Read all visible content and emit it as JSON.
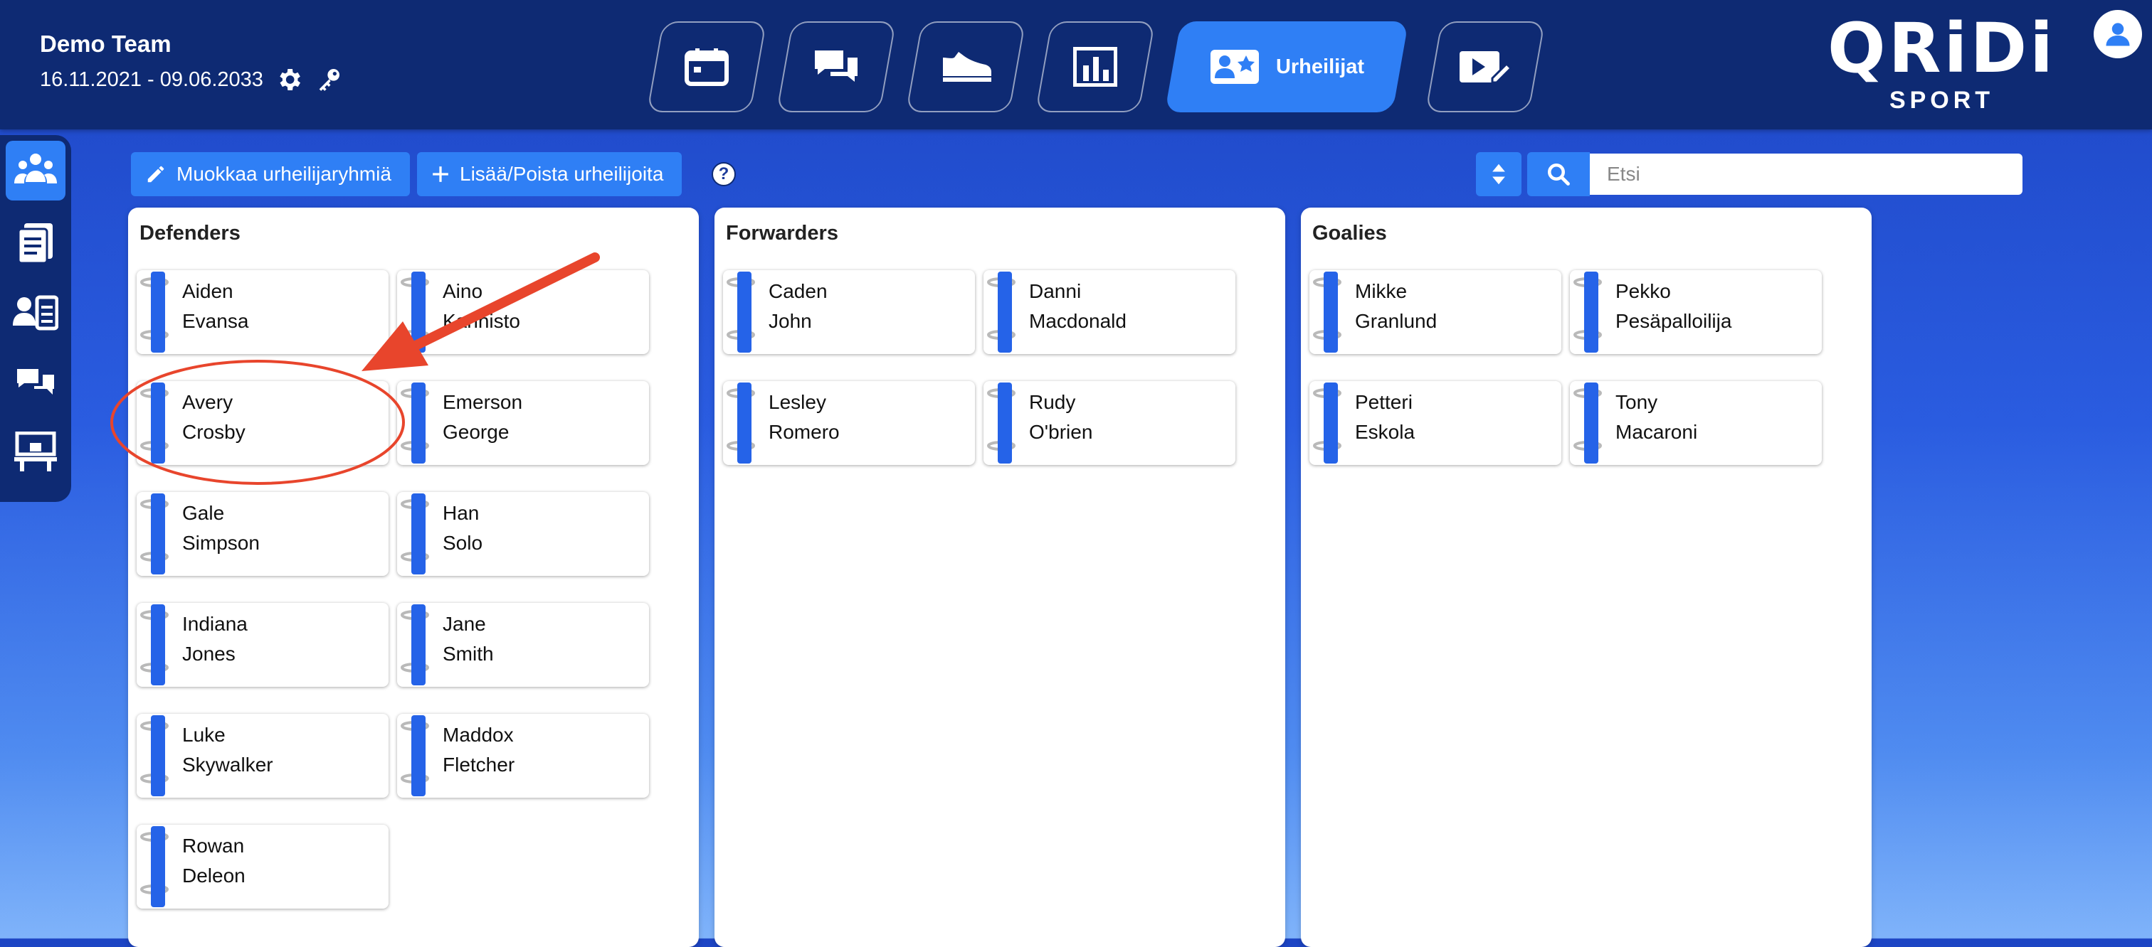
{
  "header": {
    "team_name": "Demo Team",
    "team_dates": "16.11.2021 - 09.06.2033",
    "active_tab_label": "Urheilijat",
    "logo_text": "QRiDi",
    "logo_sub": "SPORT"
  },
  "toolbar": {
    "edit_groups_label": "Muokkaa urheilijaryhmiä",
    "add_remove_label": "Lisää/Poista urheilijoita",
    "help_label": "?",
    "search_placeholder": "Etsi"
  },
  "groups": [
    {
      "title": "Defenders",
      "athletes": [
        {
          "first": "Aiden",
          "last": "Evansa"
        },
        {
          "first": "Aino",
          "last": "Kannisto"
        },
        {
          "first": "Avery",
          "last": "Crosby"
        },
        {
          "first": "Emerson",
          "last": "George"
        },
        {
          "first": "Gale",
          "last": "Simpson"
        },
        {
          "first": "Han",
          "last": "Solo"
        },
        {
          "first": "Indiana",
          "last": "Jones"
        },
        {
          "first": "Jane",
          "last": "Smith"
        },
        {
          "first": "Luke",
          "last": "Skywalker"
        },
        {
          "first": "Maddox",
          "last": "Fletcher"
        },
        {
          "first": "Rowan",
          "last": "Deleon"
        }
      ]
    },
    {
      "title": "Forwarders",
      "athletes": [
        {
          "first": "Caden",
          "last": "John"
        },
        {
          "first": "Danni",
          "last": "Macdonald"
        },
        {
          "first": "Lesley",
          "last": "Romero"
        },
        {
          "first": "Rudy",
          "last": "O'brien"
        }
      ]
    },
    {
      "title": "Goalies",
      "athletes": [
        {
          "first": "Mikke",
          "last": "Granlund"
        },
        {
          "first": "Pekko",
          "last": "Pesäpalloilija"
        },
        {
          "first": "Petteri",
          "last": "Eskola"
        },
        {
          "first": "Tony",
          "last": "Macaroni"
        }
      ]
    }
  ],
  "annotation": {
    "color": "#e8452c",
    "target": "Avery Crosby"
  },
  "colors": {
    "header_bg": "#0e2a73",
    "accent": "#2f7ff5",
    "card_bar": "#2563e8"
  }
}
